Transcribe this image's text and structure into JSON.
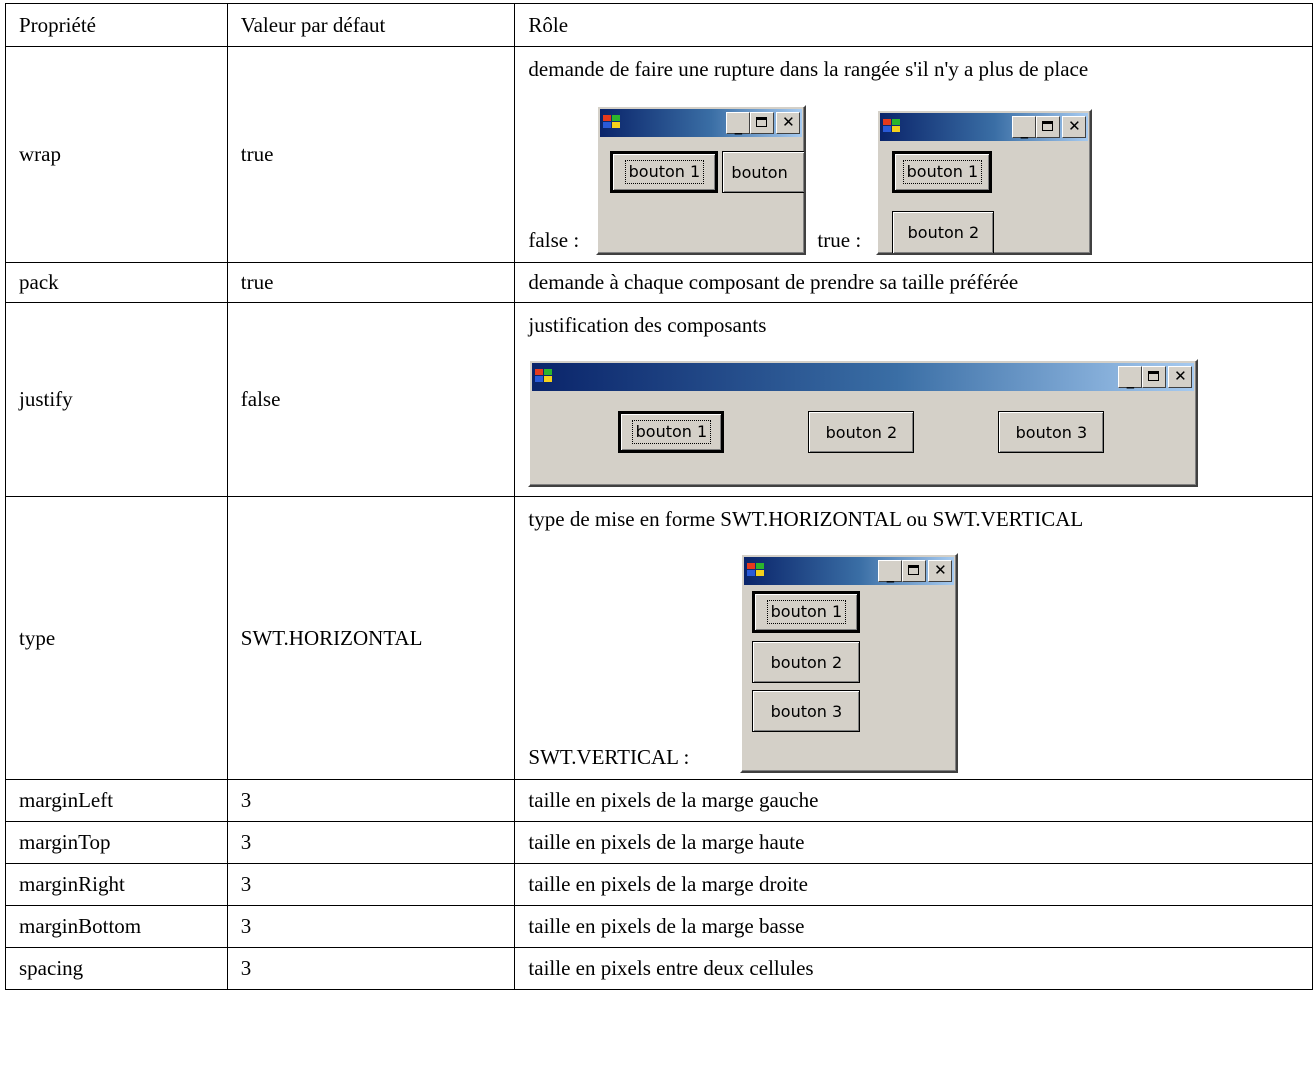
{
  "table": {
    "headers": [
      "Propriété",
      "Valeur par défaut",
      "Rôle"
    ],
    "rows": [
      {
        "prop": "wrap",
        "default": "true",
        "role": "demande de faire une rupture dans la rangée s'il n'y a plus de place"
      },
      {
        "prop": "pack",
        "default": "true",
        "role": "demande à chaque composant de prendre sa taille préférée"
      },
      {
        "prop": "justify",
        "default": "false",
        "role": "justification des composants"
      },
      {
        "prop": "type",
        "default": "SWT.HORIZONTAL",
        "role": "type de mise en forme SWT.HORIZONTAL ou SWT.VERTICAL"
      },
      {
        "prop": "marginLeft",
        "default": "3",
        "role": "taille en pixels de la marge gauche"
      },
      {
        "prop": "marginTop",
        "default": "3",
        "role": "taille en pixels de la marge haute"
      },
      {
        "prop": "marginRight",
        "default": "3",
        "role": "taille en pixels de la marge droite"
      },
      {
        "prop": "marginBottom",
        "default": "3",
        "role": "taille en pixels de la marge basse"
      },
      {
        "prop": "spacing",
        "default": "3",
        "role": "taille en pixels entre deux cellules"
      }
    ]
  },
  "captions": {
    "wrap_false": "false :",
    "wrap_true": "true :",
    "vertical": "SWT.VERTICAL :"
  },
  "buttons": {
    "b1": "bouton 1",
    "b2": "bouton 2",
    "b3": "bouton 3",
    "b2_clipped": "bouton"
  },
  "window_controls": {
    "minimize": "_",
    "close": "✕"
  }
}
